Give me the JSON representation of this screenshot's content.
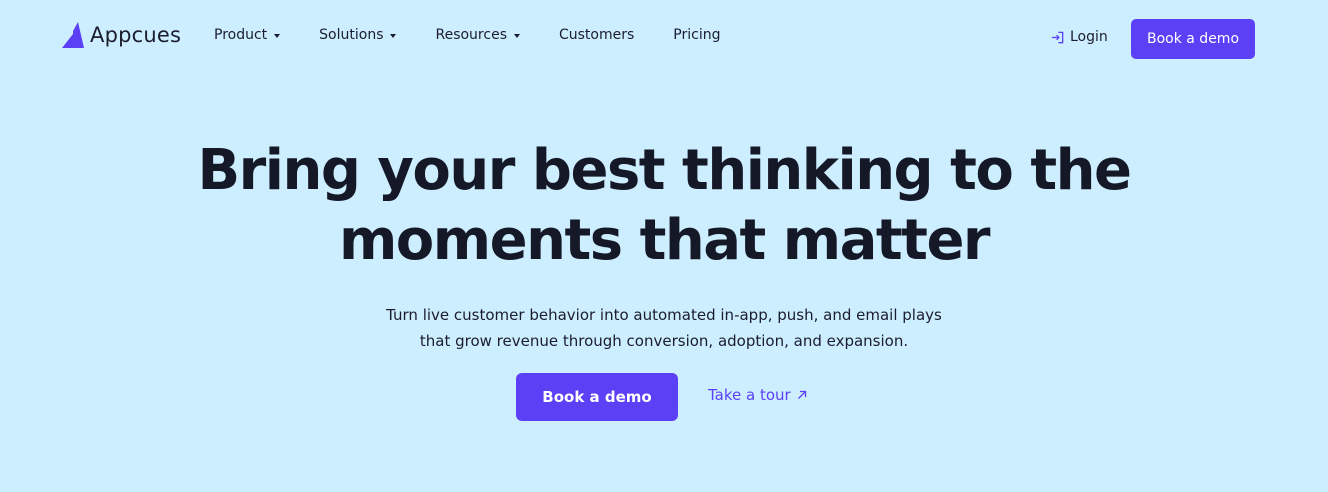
{
  "brand": {
    "name": "Appcues",
    "accent_color": "#5c40f6",
    "background_color": "#cdeefe",
    "logo_icon": "appcues-logo-icon"
  },
  "nav": {
    "items": [
      {
        "label": "Product",
        "has_dropdown": true
      },
      {
        "label": "Solutions",
        "has_dropdown": true
      },
      {
        "label": "Resources",
        "has_dropdown": true
      },
      {
        "label": "Customers",
        "has_dropdown": false
      },
      {
        "label": "Pricing",
        "has_dropdown": false
      }
    ],
    "login_label": "Login",
    "login_icon": "login-icon",
    "demo_label": "Book a demo"
  },
  "hero": {
    "title_line1": "Bring your best thinking to the",
    "title_line2": "moments that matter",
    "subtitle_line1": "Turn live customer behavior into automated in-app, push, and email plays",
    "subtitle_line2": "that grow revenue through conversion, adoption, and expansion.",
    "primary_cta": "Book a demo",
    "secondary_cta": "Take a tour",
    "secondary_cta_icon": "arrow-up-right-icon"
  }
}
